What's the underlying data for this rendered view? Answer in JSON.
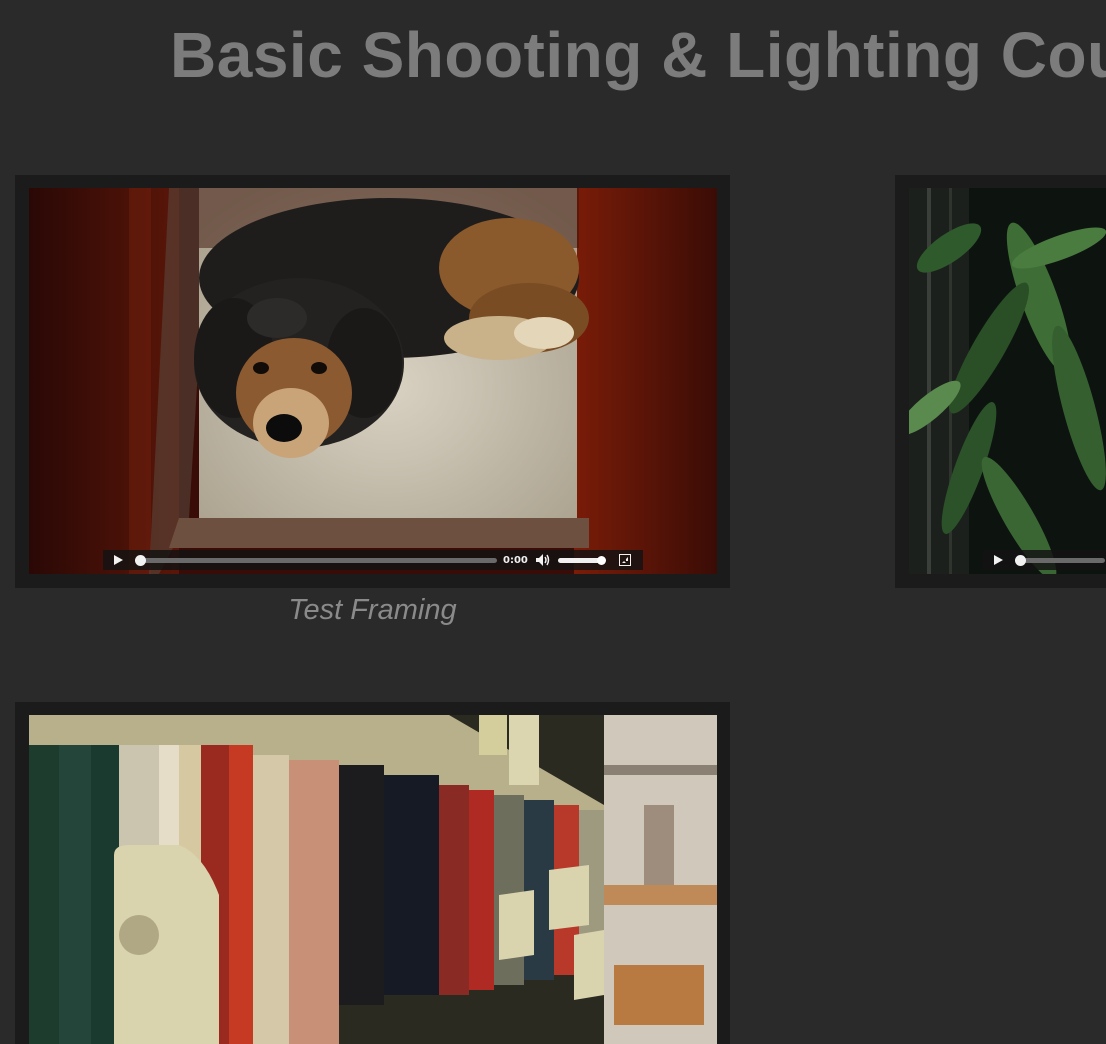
{
  "page": {
    "title": "Basic Shooting & Lighting Cour"
  },
  "videos": [
    {
      "caption": "Test Framing",
      "time": "0:00",
      "thumbnail": "dog-lying-on-carpet-framed-by-doorway"
    },
    {
      "caption": "",
      "time": "",
      "thumbnail": "green-plant-leaves"
    },
    {
      "caption": "",
      "time": "",
      "thumbnail": "library-bookshelves"
    }
  ],
  "icons": {
    "play": "play-icon",
    "volume": "volume-icon",
    "fullscreen": "fullscreen-icon"
  },
  "colors": {
    "background": "#2a2a2a",
    "card": "#1b1b1b",
    "title": "#7c7c7c",
    "caption": "#8a8a8a"
  }
}
